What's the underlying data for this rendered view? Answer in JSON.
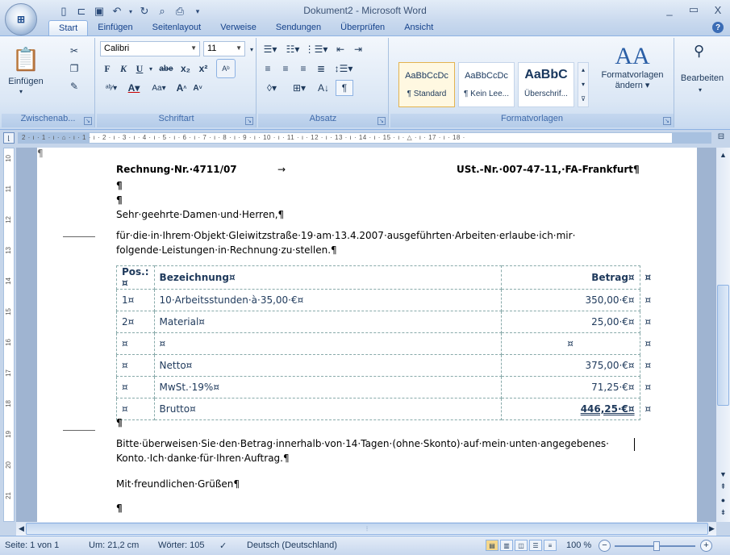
{
  "window": {
    "title": "Dokument2 - Microsoft Word",
    "office_button_label": "Office",
    "minimize": "_",
    "maximize": "▭",
    "close": "X"
  },
  "tabs": [
    "Start",
    "Einfügen",
    "Seitenlayout",
    "Verweise",
    "Sendungen",
    "Überprüfen",
    "Ansicht"
  ],
  "ribbon": {
    "clipboard": {
      "paste_label": "Einfügen",
      "group_label": "Zwischenab..."
    },
    "font": {
      "font_name": "Calibri",
      "font_size": "11",
      "group_label": "Schriftart",
      "bold": "F",
      "italic": "K",
      "underline": "U",
      "strike": "abe",
      "subscript": "x₂",
      "superscript": "x²",
      "grow": "A",
      "shrink": "A",
      "case": "Aa"
    },
    "paragraph": {
      "group_label": "Absatz",
      "pilcrow": "¶"
    },
    "styles": {
      "group_label": "Formatvorlagen",
      "items": [
        {
          "sample": "AaBbCcDc",
          "name": "¶ Standard"
        },
        {
          "sample": "AaBbCcDc",
          "name": "¶ Kein Lee..."
        },
        {
          "sample": "AaBbC",
          "name": "Überschrif..."
        }
      ],
      "change_styles_label": "Formatvorlagen",
      "change_styles_label2": "ändern"
    },
    "editing": {
      "label": "Bearbeiten"
    }
  },
  "ruler": {
    "text": "2 · ı · 1 · ı · ⌂ · ı · 1 · ı · 2 · ı · 3 · ı · 4 · ı · 5 · ı · 6 · ı · 7 · ı · 8 · ı · 9 · ı · 10 · ı · 11 · ı · 12 · ı · 13 · ı · 14 · ı · 15 · ı · △ · ı · 17 · ı · 18 ·",
    "vertical_numbers": [
      "10",
      "11",
      "12",
      "13",
      "14",
      "15",
      "16",
      "17",
      "18",
      "19",
      "20",
      "21"
    ]
  },
  "document": {
    "heading_left": "Rechnung·Nr.·4711/07",
    "heading_arrow": "→",
    "heading_right": "USt.-Nr.·007-47-11,·FA-Frankfurt¶",
    "pilcrow": "¶",
    "greeting": "Sehr·geehrte·Damen·und·Herren,¶",
    "intro_line1": "für·die·in·Ihrem·Objekt·Gleiwitzstraße·19·am·13.4.2007·ausgeführten·Arbeiten·erlaube·ich·mir·",
    "intro_line2": "folgende·Leistungen·in·Rechnung·zu·stellen.¶",
    "table": {
      "headers": [
        "Pos.:¤",
        "Bezeichnung¤",
        "Betrag¤",
        "¤"
      ],
      "rows": [
        [
          "1¤",
          "10·Arbeitsstunden·à·35,00·€¤",
          "350,00·€¤",
          "¤"
        ],
        [
          "2¤",
          "Material¤",
          "25,00·€¤",
          "¤"
        ],
        [
          "¤",
          "¤",
          "¤",
          "¤"
        ],
        [
          "¤",
          "Netto¤",
          "375,00·€¤",
          "¤"
        ],
        [
          "¤",
          "MwSt.·19%¤",
          "71,25·€¤",
          "¤"
        ],
        [
          "¤",
          "Brutto¤",
          "446,25·€¤",
          "¤"
        ]
      ]
    },
    "closing_line1": "Bitte·überweisen·Sie·den·Betrag·innerhalb·von·14·Tagen·(ohne·Skonto)·auf·mein·unten·angegebenes·",
    "closing_line2": "Konto.·Ich·danke·für·Ihren·Auftrag.¶",
    "regards": "Mit·freundlichen·Grüßen¶"
  },
  "statusbar": {
    "page": "Seite: 1 von 1",
    "position": "Um: 21,2 cm",
    "words": "Wörter: 105",
    "language": "Deutsch (Deutschland)",
    "zoom": "100 %"
  }
}
